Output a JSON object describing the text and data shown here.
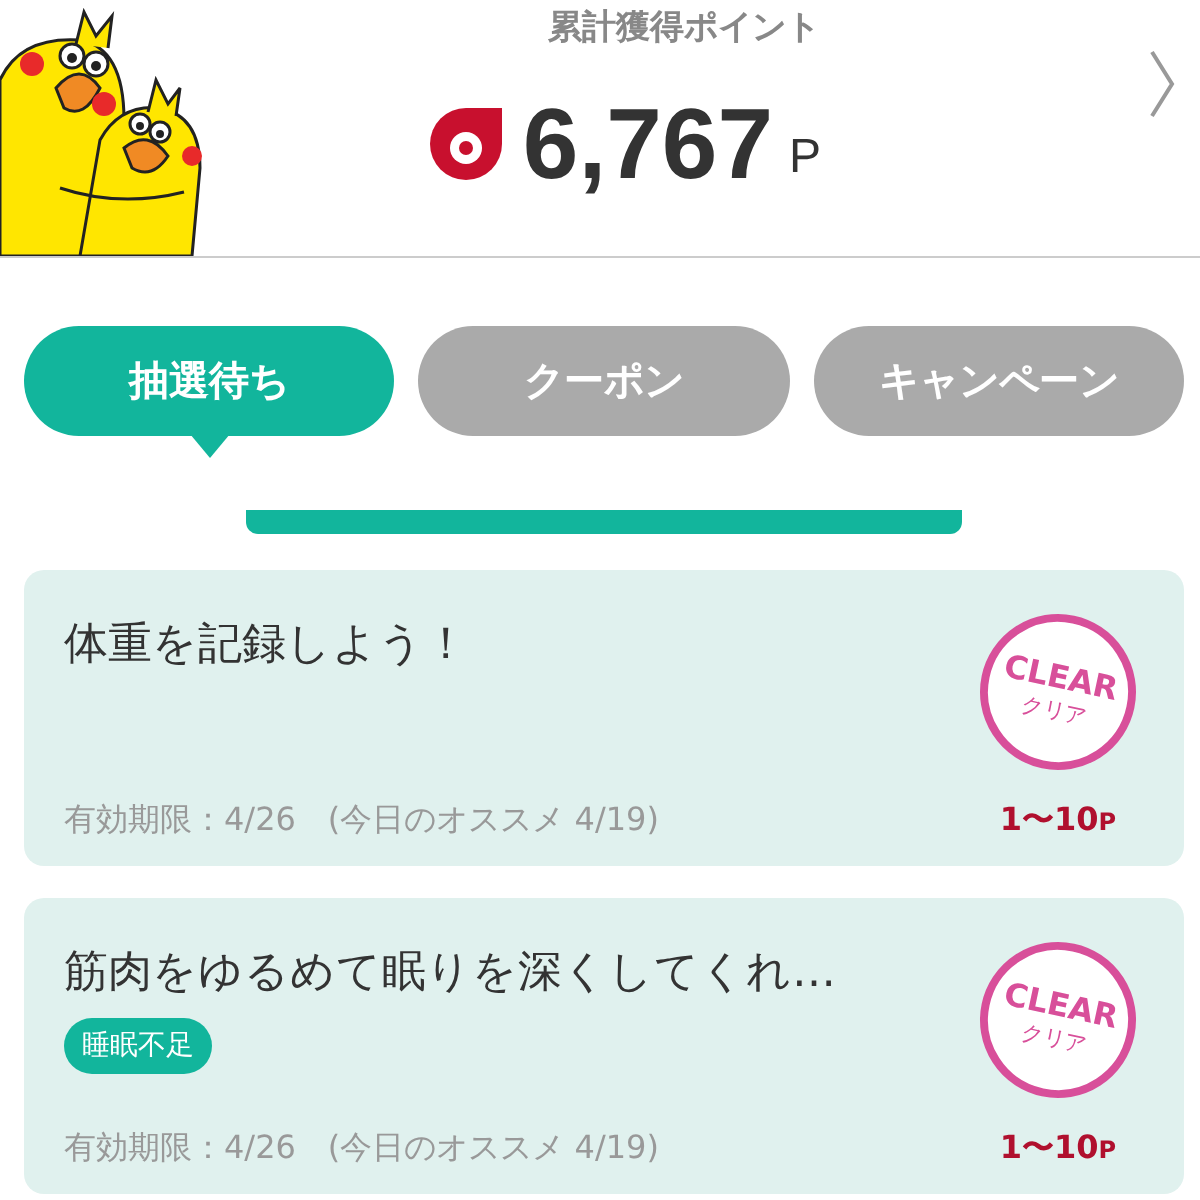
{
  "header": {
    "title": "累計獲得ポイント",
    "points": "6,767",
    "unit": "P"
  },
  "tabs": [
    {
      "label": "抽選待ち",
      "selected": true
    },
    {
      "label": "クーポン",
      "selected": false
    },
    {
      "label": "キャンペーン",
      "selected": false
    }
  ],
  "missions": [
    {
      "title": "体重を記録しよう！",
      "expiry": "有効期限：4/26",
      "recommended": "(今日のオススメ 4/19)",
      "stamp": {
        "text": "CLEAR",
        "subtext": "クリア"
      },
      "reward": "1〜10",
      "reward_unit": "P"
    },
    {
      "title": "筋肉をゆるめて眠りを深くしてくれ…",
      "tags": [
        "睡眠不足"
      ],
      "expiry": "有効期限：4/26",
      "recommended": "(今日のオススメ 4/19)",
      "stamp": {
        "text": "CLEAR",
        "subtext": "クリア"
      },
      "reward": "1〜10",
      "reward_unit": "P"
    }
  ]
}
